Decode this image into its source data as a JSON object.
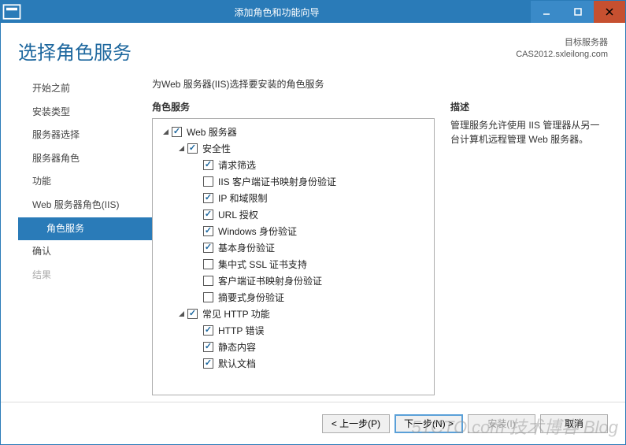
{
  "window": {
    "title": "添加角色和功能向导"
  },
  "header": {
    "page_title": "选择角色服务",
    "target_label": "目标服务器",
    "target_server": "CAS2012.sxleilong.com"
  },
  "sidebar": {
    "items": [
      {
        "label": "开始之前",
        "state": "done"
      },
      {
        "label": "安装类型",
        "state": "done"
      },
      {
        "label": "服务器选择",
        "state": "done"
      },
      {
        "label": "服务器角色",
        "state": "done"
      },
      {
        "label": "功能",
        "state": "done"
      },
      {
        "label": "Web 服务器角色(IIS)",
        "state": "done"
      },
      {
        "label": "角色服务",
        "state": "active",
        "sub": true
      },
      {
        "label": "确认",
        "state": "done"
      },
      {
        "label": "结果",
        "state": "disabled"
      }
    ]
  },
  "main": {
    "instruction": "为Web 服务器(IIS)选择要安装的角色服务",
    "tree_label": "角色服务",
    "desc_label": "描述",
    "desc_text": "管理服务允许使用 IIS 管理器从另一台计算机远程管理 Web 服务器。"
  },
  "tree": [
    {
      "depth": 0,
      "expander": "open",
      "checked": true,
      "label": "Web 服务器"
    },
    {
      "depth": 1,
      "expander": "open",
      "checked": true,
      "label": "安全性"
    },
    {
      "depth": 2,
      "expander": "none",
      "checked": true,
      "label": "请求筛选"
    },
    {
      "depth": 2,
      "expander": "none",
      "checked": false,
      "label": "IIS 客户端证书映射身份验证"
    },
    {
      "depth": 2,
      "expander": "none",
      "checked": true,
      "label": "IP 和域限制"
    },
    {
      "depth": 2,
      "expander": "none",
      "checked": true,
      "label": "URL 授权"
    },
    {
      "depth": 2,
      "expander": "none",
      "checked": true,
      "label": "Windows 身份验证"
    },
    {
      "depth": 2,
      "expander": "none",
      "checked": true,
      "label": "基本身份验证"
    },
    {
      "depth": 2,
      "expander": "none",
      "checked": false,
      "label": "集中式 SSL 证书支持"
    },
    {
      "depth": 2,
      "expander": "none",
      "checked": false,
      "label": "客户端证书映射身份验证"
    },
    {
      "depth": 2,
      "expander": "none",
      "checked": false,
      "label": "摘要式身份验证"
    },
    {
      "depth": 1,
      "expander": "open",
      "checked": true,
      "label": "常见 HTTP 功能"
    },
    {
      "depth": 2,
      "expander": "none",
      "checked": true,
      "label": "HTTP 错误"
    },
    {
      "depth": 2,
      "expander": "none",
      "checked": true,
      "label": "静态内容"
    },
    {
      "depth": 2,
      "expander": "none",
      "checked": true,
      "label": "默认文档"
    }
  ],
  "footer": {
    "prev": "< 上一步(P)",
    "next": "下一步(N) >",
    "install": "安装(I)",
    "cancel": "取消"
  },
  "watermark": "51CTO.com 技术博客 Blog"
}
